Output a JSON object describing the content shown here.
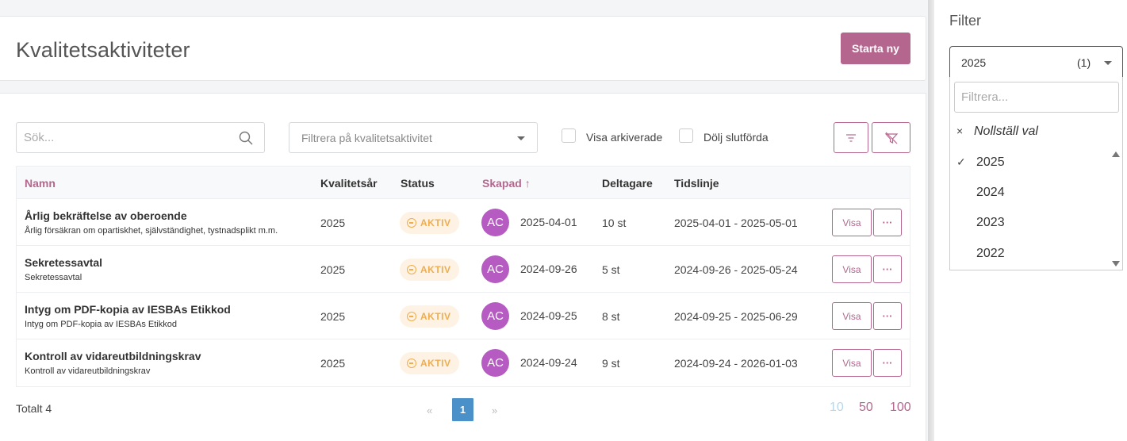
{
  "header": {
    "title": "Kvalitetsaktiviteter",
    "start_button": "Starta ny"
  },
  "toolbar": {
    "search_placeholder": "Sök...",
    "activity_filter_placeholder": "Filtrera på kvalitetsaktivitet",
    "show_archived_label": "Visa arkiverade",
    "hide_completed_label": "Dölj slutförda"
  },
  "table": {
    "columns": {
      "name": "Namn",
      "year": "Kvalitetsår",
      "status": "Status",
      "created": "Skapad",
      "sort_arrow": "↑",
      "participants": "Deltagare",
      "timeline": "Tidslinje"
    },
    "rows": [
      {
        "name": "Årlig bekräftelse av oberoende",
        "description": "Årlig försäkran om opartiskhet, självständighet, tystnadsplikt m.m.",
        "year": "2025",
        "status": "AKTIV",
        "avatar": "AC",
        "created": "2025-04-01",
        "participants": "10 st",
        "timeline": "2025-04-01 - 2025-05-01",
        "view": "Visa",
        "more": "···"
      },
      {
        "name": "Sekretessavtal",
        "description": "Sekretessavtal",
        "year": "2025",
        "status": "AKTIV",
        "avatar": "AC",
        "created": "2024-09-26",
        "participants": "5 st",
        "timeline": "2024-09-26 - 2025-05-24",
        "view": "Visa",
        "more": "···"
      },
      {
        "name": "Intyg om PDF-kopia av IESBAs Etikkod",
        "description": "Intyg om PDF-kopia av IESBAs Etikkod",
        "year": "2025",
        "status": "AKTIV",
        "avatar": "AC",
        "created": "2024-09-25",
        "participants": "8 st",
        "timeline": "2024-09-25 - 2025-06-29",
        "view": "Visa",
        "more": "···"
      },
      {
        "name": "Kontroll av vidareutbildningskrav",
        "description": "Kontroll av vidareutbildningskrav",
        "year": "2025",
        "status": "AKTIV",
        "avatar": "AC",
        "created": "2024-09-24",
        "participants": "9 st",
        "timeline": "2024-09-24 - 2026-01-03",
        "view": "Visa",
        "more": "···"
      }
    ]
  },
  "footer": {
    "total": "Totalt 4",
    "prev": "«",
    "current_page": "1",
    "next": "»",
    "page_sizes": [
      "10",
      "50",
      "100"
    ]
  },
  "filter_panel": {
    "title": "Filter",
    "selected_value": "2025",
    "selected_count": "(1)",
    "search_placeholder": "Filtrera...",
    "reset_label": "Nollställ val",
    "reset_icon": "×",
    "check_icon": "✓",
    "options": [
      "2025",
      "2024",
      "2023",
      "2022"
    ]
  },
  "colors": {
    "accent": "#b5668f",
    "status_active": "#f0ad4e",
    "pagination_active": "#4a90c9",
    "avatar": "#b55bc2"
  }
}
